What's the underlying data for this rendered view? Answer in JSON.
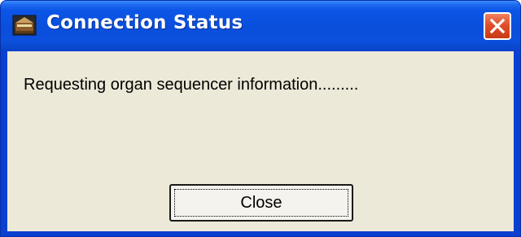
{
  "window": {
    "title": "Connection Status",
    "icon": "organ-app-icon",
    "close_icon": "close-icon"
  },
  "content": {
    "message": "Requesting organ sequencer information........."
  },
  "buttons": {
    "close_label": "Close"
  },
  "colors": {
    "titlebar": "#0a4fdc",
    "client_background": "#ece9d8",
    "close_button": "#e0502a"
  }
}
